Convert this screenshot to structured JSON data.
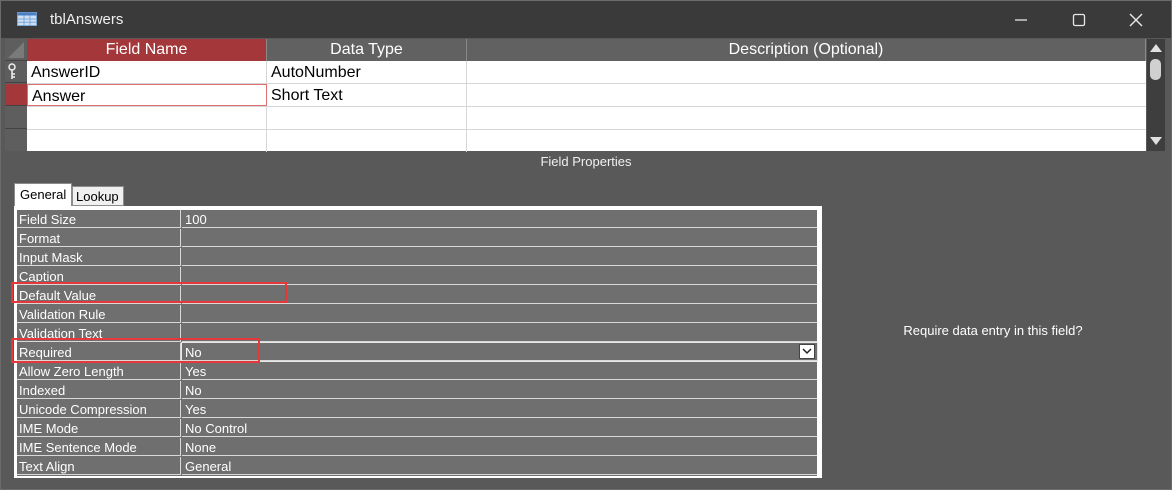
{
  "window": {
    "title": "tblAnswers",
    "controls": [
      "minimize-icon",
      "maximize-icon",
      "close-icon"
    ]
  },
  "grid": {
    "columns": [
      "Field Name",
      "Data Type",
      "Description (Optional)"
    ],
    "rows": [
      {
        "name": "AnswerID",
        "type": "AutoNumber",
        "description": "",
        "primary_key": true
      },
      {
        "name": "Answer",
        "type": "Short Text",
        "description": "",
        "selected": true
      },
      {
        "name": "",
        "type": "",
        "description": ""
      },
      {
        "name": "",
        "type": "",
        "description": ""
      }
    ]
  },
  "field_properties": {
    "label": "Field Properties",
    "tabs": [
      "General",
      "Lookup"
    ],
    "active_tab": "General",
    "rows": [
      {
        "name": "Field Size",
        "value": "100"
      },
      {
        "name": "Format",
        "value": ""
      },
      {
        "name": "Input Mask",
        "value": ""
      },
      {
        "name": "Caption",
        "value": ""
      },
      {
        "name": "Default Value",
        "value": ""
      },
      {
        "name": "Validation Rule",
        "value": ""
      },
      {
        "name": "Validation Text",
        "value": ""
      },
      {
        "name": "Required",
        "value": "No"
      },
      {
        "name": "Allow Zero Length",
        "value": "Yes"
      },
      {
        "name": "Indexed",
        "value": "No"
      },
      {
        "name": "Unicode Compression",
        "value": "Yes"
      },
      {
        "name": "IME Mode",
        "value": "No Control"
      },
      {
        "name": "IME Sentence Mode",
        "value": "None"
      },
      {
        "name": "Text Align",
        "value": "General"
      }
    ],
    "help_text": "Require data entry in this field?"
  },
  "colors": {
    "accent": "#a4373a",
    "highlight_box": "#e5383b",
    "background": "#595959"
  }
}
